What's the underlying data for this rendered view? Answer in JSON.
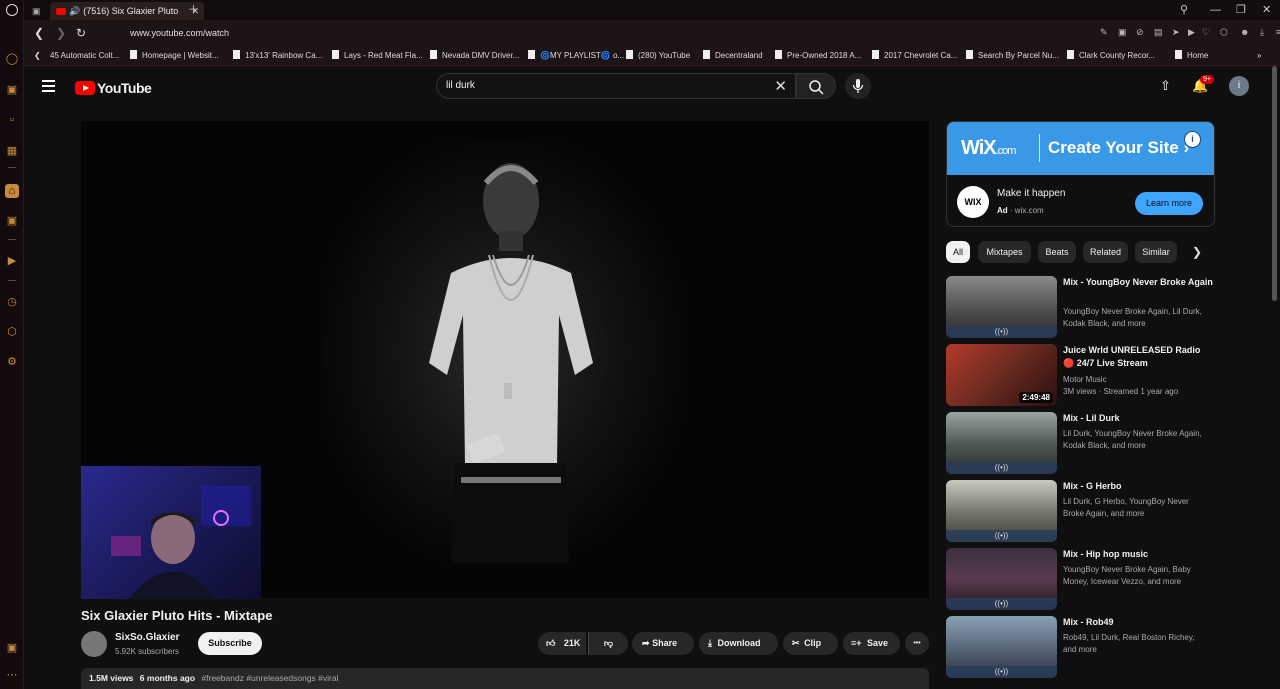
{
  "browser": {
    "tab_title": "(7516) Six Glaxier Pluto",
    "url": "www.youtube.com/watch",
    "bookmarks": [
      "45 Automatic Colt...",
      "Homepage | Websit...",
      "13'x13' Rainbow Ca...",
      "Lays - Red Meat Fla...",
      "Nevada DMV Driver...",
      "🌀MY PLAYLIST🌀 o...",
      "(280) YouTube",
      "Decentraland",
      "Pre-Owned 2018 A...",
      "2017 Chevrolet Ca...",
      "Search By Parcel Nu...",
      "Clark County Recor...",
      "Home"
    ]
  },
  "youtube": {
    "logo_text": "YouTube",
    "search_value": "lil durk",
    "notification_count": "9+",
    "avatar_letter": "i"
  },
  "video": {
    "title": "Six Glaxier Pluto Hits - Mixtape",
    "channel": "SixSo.Glaxier",
    "subscribers": "5.92K subscribers",
    "subscribe_label": "Subscribe",
    "likes": "21K",
    "share_label": "Share",
    "download_label": "Download",
    "clip_label": "Clip",
    "save_label": "Save",
    "more_label": "•••",
    "views": "1.5M views",
    "age": "6 months ago",
    "tags": "#freebandz #unreleasedsongs #viral"
  },
  "ad": {
    "brand": "WiX",
    "brand_suffix": ".com",
    "tagline": "Create Your Site",
    "icon_text": "WIX",
    "headline": "Make it happen",
    "ad_label": "Ad",
    "domain": "· wix.com",
    "cta": "Learn more"
  },
  "chips": [
    "All",
    "Mixtapes",
    "Beats",
    "Related",
    "Similar"
  ],
  "recommendations": [
    {
      "title": "Mix - YoungBoy Never Broke Again",
      "meta1": "YoungBoy Never Broke Again, Lil Durk, Kodak Black, and more",
      "meta2": "",
      "badge": "((•))",
      "duration": ""
    },
    {
      "title": "Juice Wrld UNRELEASED Radio 🔴 24/7 Live Stream",
      "meta1": "Motor Music",
      "meta2": "3M views · Streamed 1 year ago",
      "badge": "",
      "duration": "2:49:48"
    },
    {
      "title": "Mix - Lil Durk",
      "meta1": "Lil Durk, YoungBoy Never Broke Again, Kodak Black, and more",
      "meta2": "",
      "badge": "((•))",
      "duration": ""
    },
    {
      "title": "Mix - G Herbo",
      "meta1": "Lil Durk, G Herbo, YoungBoy Never Broke Again, and more",
      "meta2": "",
      "badge": "((•))",
      "duration": ""
    },
    {
      "title": "Mix - Hip hop music",
      "meta1": "YoungBoy Never Broke Again, Baby Money, Icewear Vezzo, and more",
      "meta2": "",
      "badge": "((•))",
      "duration": ""
    },
    {
      "title": "Mix - Rob49",
      "meta1": "Rob49, Lil Durk, Real Boston Richey, and more",
      "meta2": "",
      "badge": "((•))",
      "duration": ""
    }
  ],
  "colors": {
    "accent_red": "#ff0000",
    "wix_blue": "#3a99e6",
    "cta_blue": "#3ea6ff",
    "opera_gold": "#c88a3a"
  }
}
